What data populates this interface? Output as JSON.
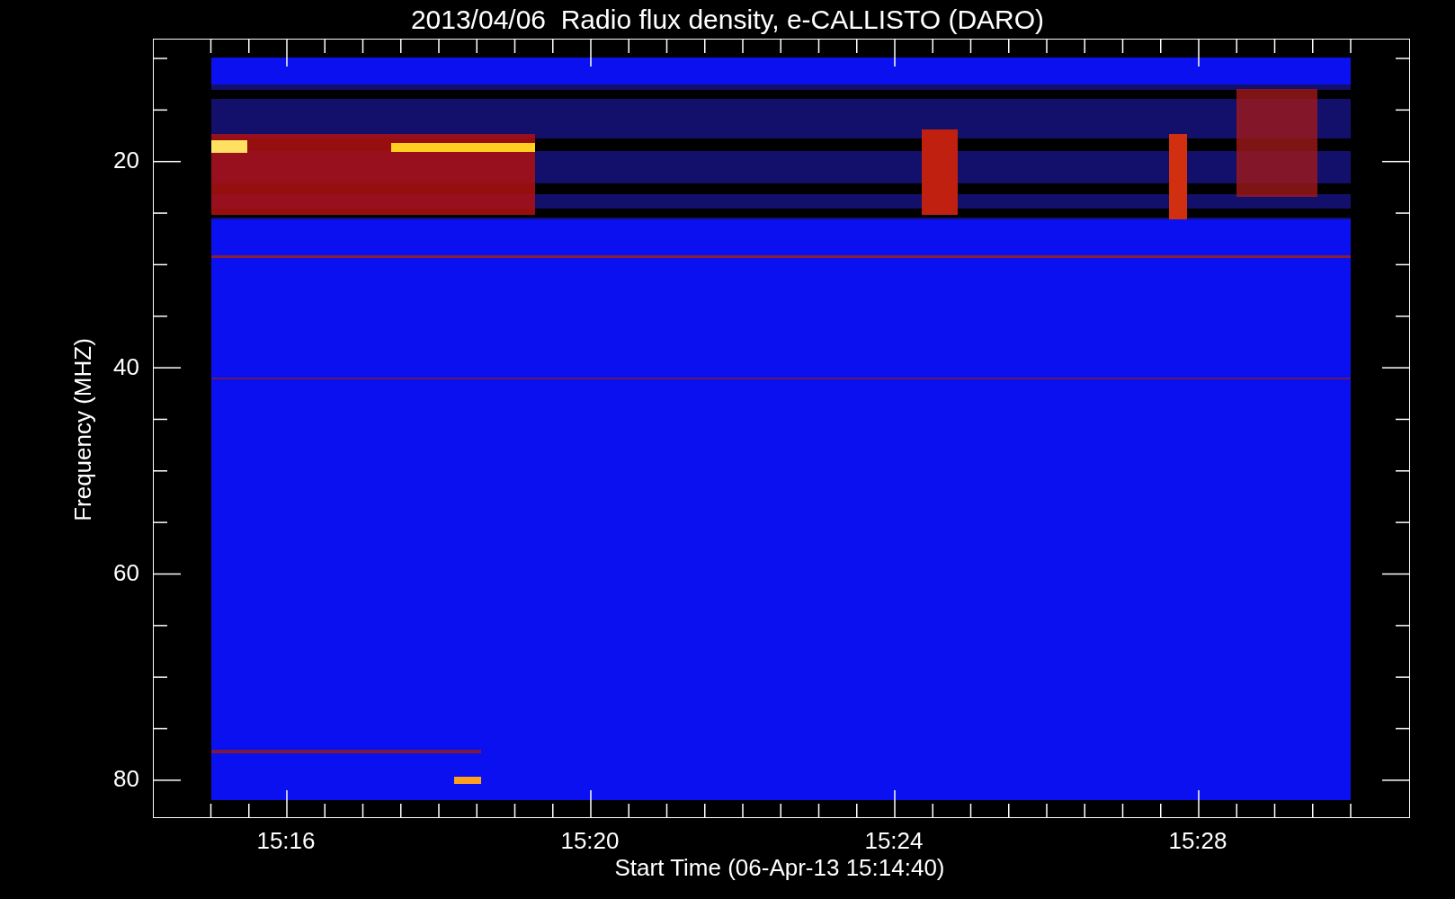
{
  "title": "2013/04/06  Radio flux density, e-CALLISTO (DARO)",
  "ylabel": "Frequency (MHZ)",
  "xlabel": "Start Time (06-Apr-13 15:14:40)",
  "yticks": [
    "20",
    "40",
    "60",
    "80"
  ],
  "xticks": [
    "15:16",
    "15:20",
    "15:24",
    "15:28"
  ]
}
